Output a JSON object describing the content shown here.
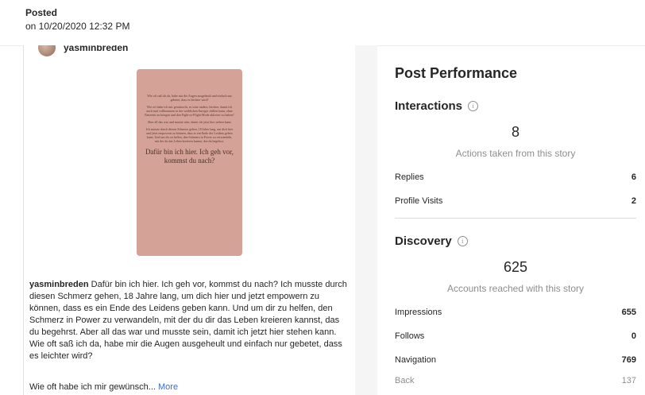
{
  "header": {
    "posted_label": "Posted",
    "posted_date": "on 10/20/2020 12:32 PM"
  },
  "post": {
    "username": "yasminbreden",
    "story": {
      "small_paragraphs": [
        "Wie oft saß ich da, habe mir die Augen ausgeheult und einfach nur gebetet, dass es leichter wird?",
        "Wie oft habe ich mir gewünscht, es wäre anders, leichter, damit ich auch mal vollkommen in der weiblichen Energie chillen kann, ohne Panzerin zu kriegen und den Fight-or-Flight-Mode aktiviert zu haben?",
        "Aber all das war und musste sein, damit ich jetzt hier stehen kann.",
        "Ich musste durch diesen Schmerz gehen, 18 Jahre lang, um dich hier und jetzt empowern zu können, dass es ein Ende des Leidens geben kann. Und um dir zu helfen, den Schmerz in Power zu verwandeln, mit der du das Leben kreieren kannst, das du begehrst."
      ],
      "big_text": "Dafür bin ich hier. Ich geh vor, kommst du nach?"
    },
    "caption_user": "yasminbreden",
    "caption_text": " Dafür bin ich hier. Ich geh vor, kommst du nach? Ich musste durch diesen Schmerz gehen, 18 Jahre lang, um dich hier und jetzt empowern zu können, dass es ein Ende des Leidens geben kann. Und um dir zu helfen, den Schmerz in Power zu verwandeln, mit der du dir das Leben kreieren kannst, das du begehrst. Aber all das war und musste sein, damit ich jetzt hier stehen kann. Wie oft saß ich da, habe mir die Augen ausgeheult und einfach nur gebetet, dass es leichter wird?",
    "caption_tail": "Wie oft habe ich mir gewünsch... ",
    "more_label": "More"
  },
  "performance": {
    "title": "Post Performance",
    "interactions": {
      "label": "Interactions",
      "info_icon": "ⓘ",
      "total": "8",
      "subtitle": "Actions taken from this story",
      "rows": [
        {
          "label": "Replies",
          "value": "6"
        },
        {
          "label": "Profile Visits",
          "value": "2"
        }
      ]
    },
    "discovery": {
      "label": "Discovery",
      "info_icon": "ⓘ",
      "total": "625",
      "subtitle": "Accounts reached with this story",
      "rows": [
        {
          "label": "Impressions",
          "value": "655"
        },
        {
          "label": "Follows",
          "value": "0"
        },
        {
          "label": "Navigation",
          "value": "769"
        },
        {
          "label": "Back",
          "value": "137"
        }
      ]
    }
  }
}
